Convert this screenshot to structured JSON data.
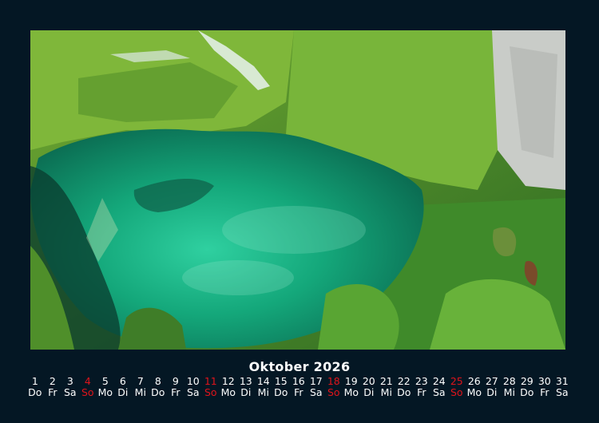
{
  "calendar": {
    "month_title": "Oktober 2026",
    "days": [
      {
        "n": "1",
        "wd": "Do"
      },
      {
        "n": "2",
        "wd": "Fr"
      },
      {
        "n": "3",
        "wd": "Sa"
      },
      {
        "n": "4",
        "wd": "So"
      },
      {
        "n": "5",
        "wd": "Mo"
      },
      {
        "n": "6",
        "wd": "Di"
      },
      {
        "n": "7",
        "wd": "Mi"
      },
      {
        "n": "8",
        "wd": "Do"
      },
      {
        "n": "9",
        "wd": "Fr"
      },
      {
        "n": "10",
        "wd": "Sa"
      },
      {
        "n": "11",
        "wd": "So"
      },
      {
        "n": "12",
        "wd": "Mo"
      },
      {
        "n": "13",
        "wd": "Di"
      },
      {
        "n": "14",
        "wd": "Mi"
      },
      {
        "n": "15",
        "wd": "Do"
      },
      {
        "n": "16",
        "wd": "Fr"
      },
      {
        "n": "17",
        "wd": "Sa"
      },
      {
        "n": "18",
        "wd": "So"
      },
      {
        "n": "19",
        "wd": "Mo"
      },
      {
        "n": "20",
        "wd": "Di"
      },
      {
        "n": "21",
        "wd": "Mi"
      },
      {
        "n": "22",
        "wd": "Do"
      },
      {
        "n": "23",
        "wd": "Fr"
      },
      {
        "n": "24",
        "wd": "Sa"
      },
      {
        "n": "25",
        "wd": "So"
      },
      {
        "n": "26",
        "wd": "Mo"
      },
      {
        "n": "27",
        "wd": "Di"
      },
      {
        "n": "28",
        "wd": "Mi"
      },
      {
        "n": "29",
        "wd": "Do"
      },
      {
        "n": "30",
        "wd": "Fr"
      },
      {
        "n": "31",
        "wd": "Sa"
      }
    ],
    "sunday_label": "So"
  },
  "colors": {
    "background": "#041724",
    "text": "#ffffff",
    "sunday": "#e0141b"
  }
}
